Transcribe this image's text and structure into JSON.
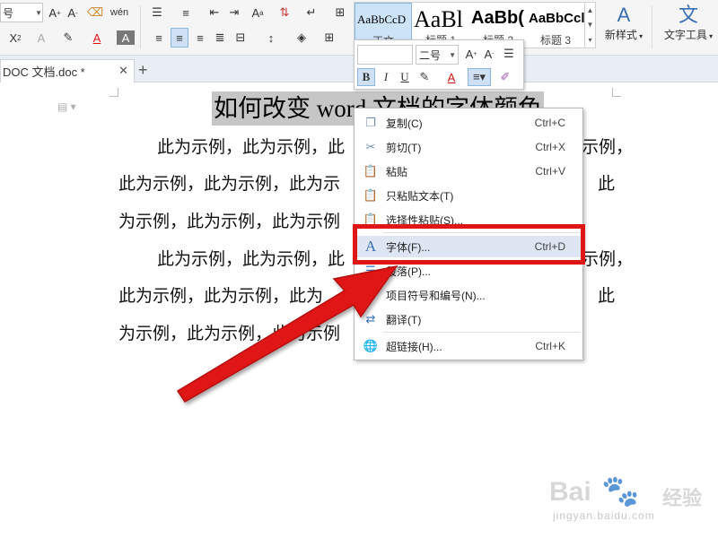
{
  "ribbon": {
    "font_size_value": "号",
    "style_gallery": [
      {
        "sample": "AaBbCcD",
        "name": "正文"
      },
      {
        "sample": "AaBl",
        "name": "标题 1"
      },
      {
        "sample": "AaBb(",
        "name": "标题 2"
      },
      {
        "sample": "AaBbCcl",
        "name": "标题 3"
      }
    ],
    "new_style_label": "新样式",
    "text_tools_label": "文字工具"
  },
  "tabs": {
    "doc_tab_label": "DOC 文档.doc *"
  },
  "document": {
    "heading": "如何改变 word 文档的字体颜色",
    "lines": [
      "此为示例，此为示例，此",
      "此为示例，此为示例，此为示",
      "为示例，此为示例，此为示例",
      "此为示例，此为示例，此",
      "此为示例，此为示例，此为",
      "为示例，此为示例，此为示例"
    ],
    "right_fragments": [
      "示例，",
      "此",
      "示例，",
      "此"
    ]
  },
  "mini_toolbar": {
    "font_name": "",
    "font_size": "二号"
  },
  "context_menu": {
    "items": [
      {
        "icon": "copy-icon",
        "label": "复制(C)",
        "shortcut": "Ctrl+C"
      },
      {
        "icon": "cut-icon",
        "label": "剪切(T)",
        "shortcut": "Ctrl+X"
      },
      {
        "icon": "paste-icon",
        "label": "粘贴",
        "shortcut": "Ctrl+V"
      },
      {
        "icon": "paste-text-icon",
        "label": "只粘贴文本(T)",
        "shortcut": ""
      },
      {
        "icon": "paste-special-icon",
        "label": "选择性粘贴(S)...",
        "shortcut": ""
      },
      {
        "icon": "font-icon",
        "label": "字体(F)...",
        "shortcut": "Ctrl+D"
      },
      {
        "icon": "paragraph-icon",
        "label": "段落(P)...",
        "shortcut": ""
      },
      {
        "icon": "bullets-icon",
        "label": "项目符号和编号(N)...",
        "shortcut": ""
      },
      {
        "icon": "translate-icon",
        "label": "翻译(T)",
        "shortcut": ""
      },
      {
        "icon": "hyperlink-icon",
        "label": "超链接(H)...",
        "shortcut": "Ctrl+K"
      }
    ],
    "highlighted_index": 5
  },
  "watermark": {
    "logo": "Bai",
    "brand": "经验",
    "url": "jingyan.baidu.com"
  },
  "colors": {
    "highlight_red": "#e01616",
    "selection_gray": "#c6c6c6",
    "menu_hover": "#dde6f2"
  }
}
